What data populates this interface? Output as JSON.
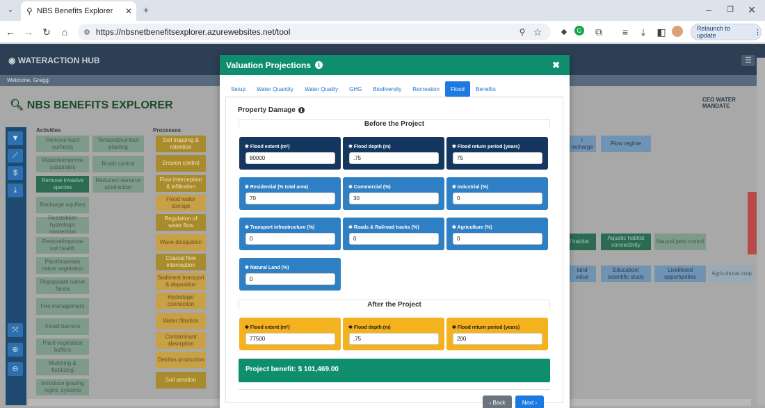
{
  "browser": {
    "tab_title": "NBS Benefits Explorer",
    "url": "https://nbsnetbenefitsexplorer.azurewebsites.net/tool",
    "relaunch_label": "Relaunch to update"
  },
  "app": {
    "logo": "WATERACTION HUB",
    "welcome": "Welcome, Gregg.",
    "title": "NBS BENEFITS EXPLORER",
    "badge": "CEO WATER MANDATE",
    "contact_tab": "Contact Us",
    "columns": {
      "activities": "Activities",
      "processes": "Processes"
    },
    "activities": [
      "Remove hard surfaces",
      "Restore/improve substrates",
      "Remove invasive species",
      "Recharge aquifers",
      "Reestablish hydrologic connection",
      "Restore/improve soil health",
      "Plant/maintain native vegetation",
      "Repopulate native fauna",
      "Fire management",
      "Install barriers",
      "Plant vegetation buffers",
      "Mulching & fertilizing",
      "Introduce grazing mgmt. systems"
    ],
    "activities2": [
      "Terraced/contour planting",
      "Brush control",
      "Reduced resource abstraction"
    ],
    "processes": [
      "Soil trapping & retention",
      "Erosion control",
      "Flow interception & infiltration",
      "Flood water storage",
      "Regulation of water flow",
      "Wave dissipation",
      "Coastal flow interception",
      "Sediment transport & deposition",
      "Hydrologic connection",
      "Water filtration",
      "Contaminant absorption",
      "Detritus production",
      "Soil aeration"
    ],
    "right_tiles": [
      "Flow regime",
      "Aquatic habitat connectivity",
      "Natural pest control",
      "Education/ scientific study",
      "Livelihood opportunities",
      "Agricultural outp"
    ],
    "right_partial": [
      "r recharge",
      "l habitat",
      "land value"
    ]
  },
  "modal": {
    "title": "Valuation Projections",
    "tabs": [
      "Setup",
      "Water Quantity",
      "Water Quality",
      "GHG",
      "Biodiversity",
      "Recreation",
      "Flood",
      "Benefits"
    ],
    "active_tab": "Flood",
    "section_title": "Property Damage",
    "before_label": "Before the Project",
    "after_label": "After the Project",
    "before": [
      {
        "label": "✱ Flood extent (m²)",
        "value": "80000",
        "style": "dark"
      },
      {
        "label": "✱ Flood depth (m)",
        "value": ".75",
        "style": "dark"
      },
      {
        "label": "✱ Flood return period (years)",
        "value": "75",
        "style": "dark"
      },
      {
        "label": "✱ Residential (% total area)",
        "value": "70",
        "style": "mid"
      },
      {
        "label": "✱ Commercial (%)",
        "value": "30",
        "style": "mid"
      },
      {
        "label": "✱ Industrial (%)",
        "value": "0",
        "style": "mid"
      },
      {
        "label": "✱ Transport infrastructure (%)",
        "value": "0",
        "style": "mid"
      },
      {
        "label": "✱ Roads & Railroad tracks (%)",
        "value": "0",
        "style": "mid"
      },
      {
        "label": "✱ Agriculture (%)",
        "value": "0",
        "style": "mid"
      },
      {
        "label": "✱ Natural Land (%)",
        "value": "0",
        "style": "mid"
      }
    ],
    "after": [
      {
        "label": "✱ Flood extent (m²)",
        "value": "77500"
      },
      {
        "label": "✱ Flood depth (m)",
        "value": ".75"
      },
      {
        "label": "✱ Flood return period (years)",
        "value": "200"
      }
    ],
    "benefit": "Project benefit: $ 101,469.00",
    "back_label": "‹ Back",
    "next_label": "Next ›"
  },
  "colors": {
    "modal_header": "#0f8e6e",
    "dark_cell": "#15375f",
    "mid_cell": "#2f7fc4",
    "after_cell": "#f3b21e",
    "active_tab": "#1b79e0"
  }
}
